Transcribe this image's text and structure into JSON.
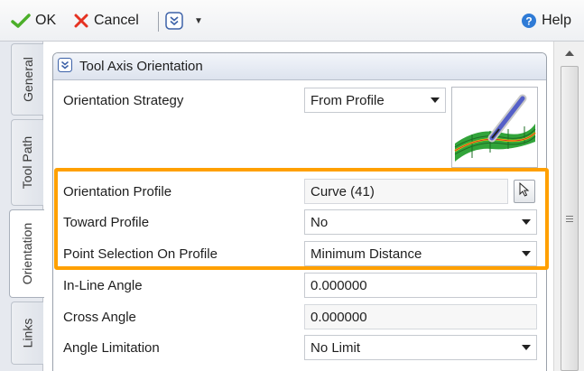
{
  "toolbar": {
    "ok_label": "OK",
    "cancel_label": "Cancel",
    "help_label": "Help"
  },
  "tabs": [
    {
      "label": "General"
    },
    {
      "label": "Tool Path"
    },
    {
      "label": "Orientation",
      "active": true
    },
    {
      "label": "Links"
    }
  ],
  "section": {
    "title": "Tool Axis Orientation"
  },
  "fields": {
    "orientation_strategy": {
      "label": "Orientation Strategy",
      "value": "From Profile"
    },
    "orientation_profile": {
      "label": "Orientation Profile",
      "value": "Curve (41)"
    },
    "toward_profile": {
      "label": "Toward Profile",
      "value": "No"
    },
    "point_selection": {
      "label": "Point Selection On Profile",
      "value": "Minimum Distance"
    },
    "inline_angle": {
      "label": "In-Line Angle",
      "value": "0.000000"
    },
    "cross_angle": {
      "label": "Cross Angle",
      "value": "0.000000"
    },
    "angle_limitation": {
      "label": "Angle Limitation",
      "value": "No Limit"
    }
  },
  "colors": {
    "highlight": "#ffa000",
    "ok_check": "#4caf2a",
    "cancel_x": "#e53222",
    "help_blue": "#2f7bd6"
  }
}
